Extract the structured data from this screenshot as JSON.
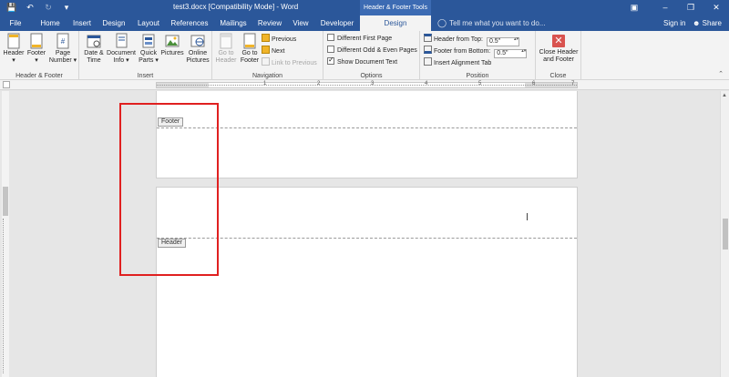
{
  "window": {
    "title": "test3.docx [Compatibility Mode] - Word",
    "context_label": "Header & Footer Tools",
    "quick_access": {
      "save_icon": "save-icon",
      "undo_icon": "undo-icon",
      "redo_icon": "redo-icon",
      "customize_icon": "qat-customize-icon"
    }
  },
  "tabs": [
    {
      "label": "File"
    },
    {
      "label": "Home"
    },
    {
      "label": "Insert"
    },
    {
      "label": "Design"
    },
    {
      "label": "Layout"
    },
    {
      "label": "References"
    },
    {
      "label": "Mailings"
    },
    {
      "label": "Review"
    },
    {
      "label": "View"
    },
    {
      "label": "Developer"
    },
    {
      "label": "Design"
    }
  ],
  "tell_me": {
    "placeholder": "Tell me what you want to do..."
  },
  "account": {
    "signin": "Sign in",
    "share": "Share"
  },
  "ribbon": {
    "header_footer": {
      "label": "Header & Footer",
      "header": "Header",
      "footer": "Footer",
      "page_number_1": "Page",
      "page_number_2": "Number"
    },
    "insert": {
      "label": "Insert",
      "date_time_1": "Date &",
      "date_time_2": "Time",
      "doc_info_1": "Document",
      "doc_info_2": "Info",
      "quick_parts_1": "Quick",
      "quick_parts_2": "Parts",
      "pictures": "Pictures",
      "online_pictures_1": "Online",
      "online_pictures_2": "Pictures"
    },
    "navigation": {
      "label": "Navigation",
      "go_to_header_1": "Go to",
      "go_to_header_2": "Header",
      "go_to_footer_1": "Go to",
      "go_to_footer_2": "Footer",
      "previous": "Previous",
      "next": "Next",
      "link_to_previous": "Link to Previous"
    },
    "options": {
      "label": "Options",
      "different_first_page": "Different First Page",
      "different_first_page_checked": false,
      "different_odd_even": "Different Odd & Even Pages",
      "different_odd_even_checked": false,
      "show_document_text": "Show Document Text",
      "show_document_text_checked": true
    },
    "position": {
      "label": "Position",
      "header_from_top": "Header from Top:",
      "header_from_top_value": "0.5\"",
      "footer_from_bottom": "Footer from Bottom:",
      "footer_from_bottom_value": "0.5\"",
      "insert_alignment_tab": "Insert Alignment Tab"
    },
    "close": {
      "label": "Close",
      "close_header_footer_1": "Close Header",
      "close_header_footer_2": "and Footer"
    }
  },
  "ruler": {
    "numbers": [
      "1",
      "2",
      "3",
      "4",
      "5",
      "6",
      "7"
    ]
  },
  "document": {
    "footer_tag": "Footer",
    "header_tag": "Header"
  },
  "colors": {
    "accent": "#2b579a",
    "annotation": "#e02020"
  }
}
